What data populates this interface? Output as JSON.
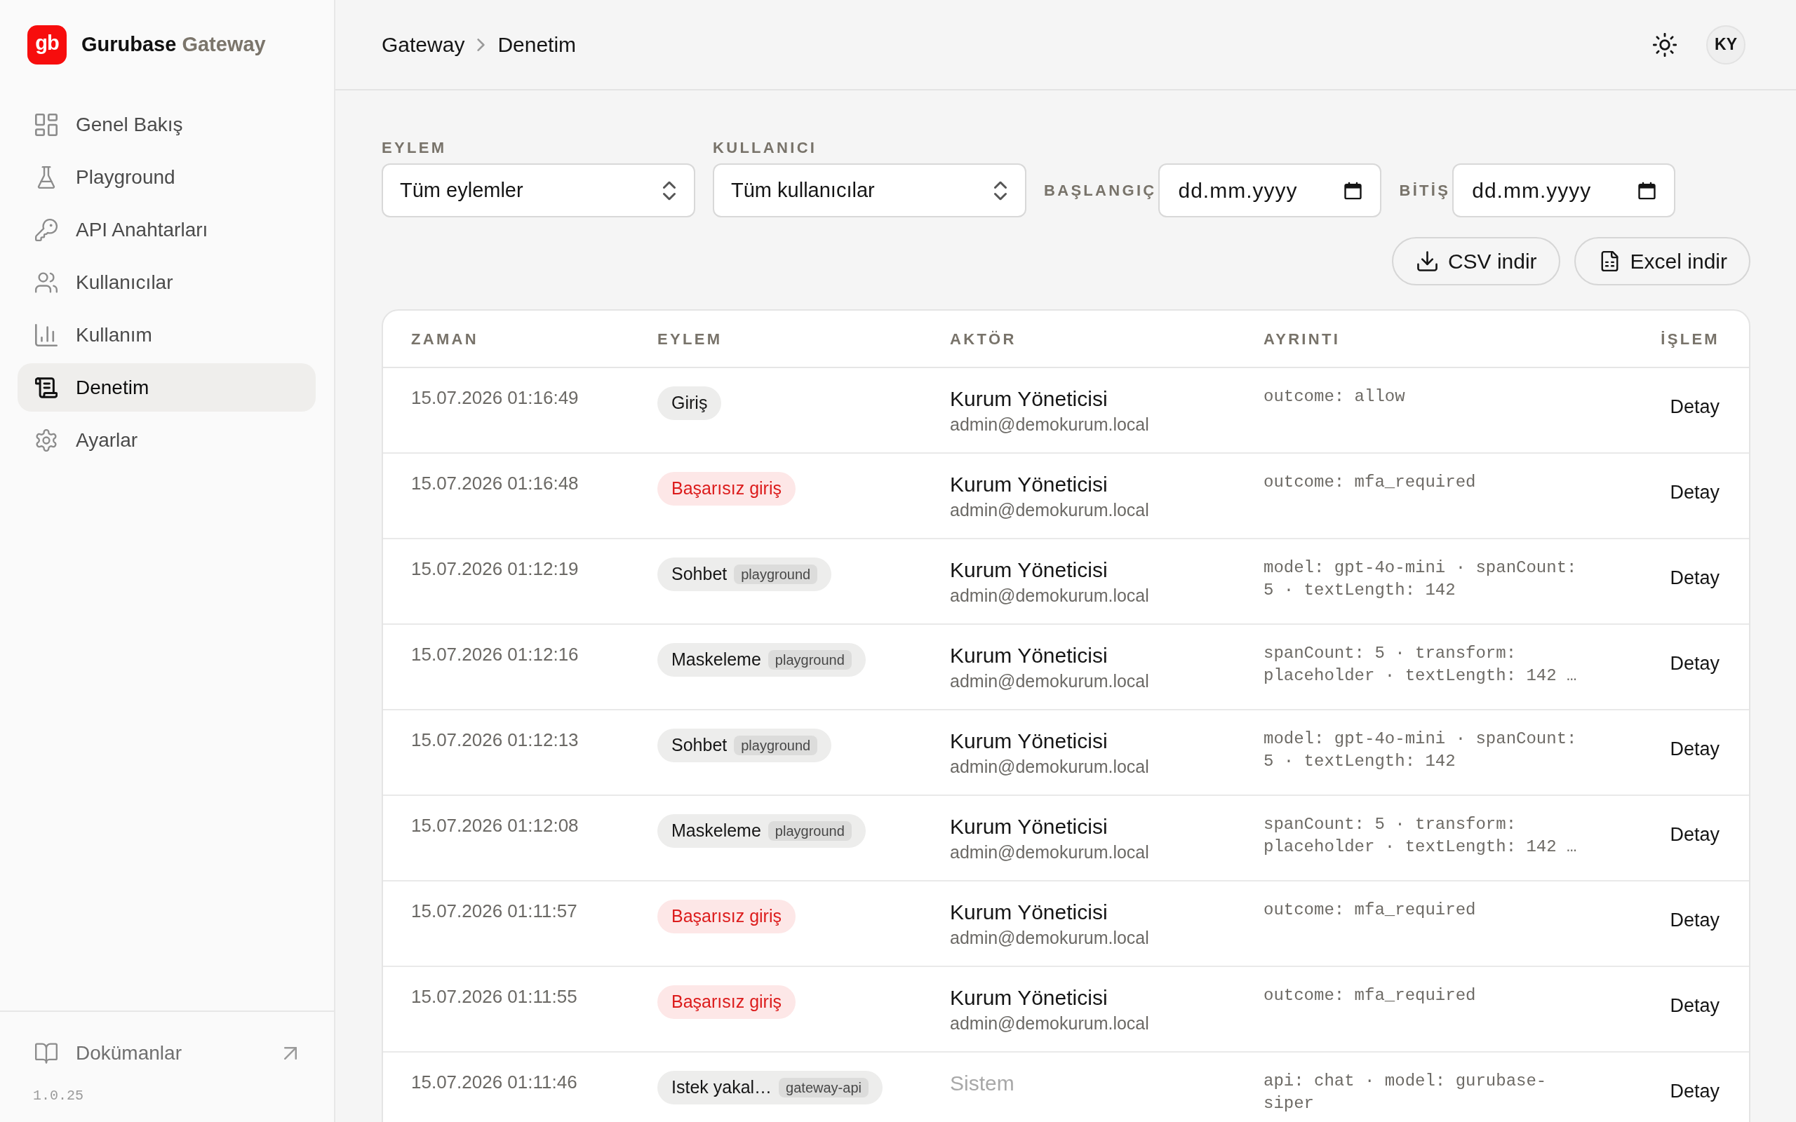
{
  "sidebar": {
    "brand": {
      "logo": "gb",
      "name": "Gurubase",
      "product": "Gateway"
    },
    "items": [
      {
        "label": "Genel Bakış",
        "selected": false
      },
      {
        "label": "Playground",
        "selected": false
      },
      {
        "label": "API Anahtarları",
        "selected": false
      },
      {
        "label": "Kullanıcılar",
        "selected": false
      },
      {
        "label": "Kullanım",
        "selected": false
      },
      {
        "label": "Denetim",
        "selected": true
      },
      {
        "label": "Ayarlar",
        "selected": false
      }
    ],
    "footer": {
      "docs_link": "Dokümanlar",
      "version": "1.0.25"
    }
  },
  "header": {
    "breadcrumb": [
      "Gateway",
      "Denetim"
    ],
    "avatar": "KY"
  },
  "filters": [
    {
      "kind": "select",
      "label": "EYLEM",
      "value": "Tüm eylemler"
    },
    {
      "kind": "select",
      "label": "KULLANICI",
      "value": "Tüm kullanıcılar"
    },
    {
      "kind": "date",
      "label": "BAŞLANGIÇ",
      "placeholder": "dd.mm.yyyy"
    },
    {
      "kind": "date",
      "label": "BİTİŞ",
      "placeholder": "dd.mm.yyyy"
    }
  ],
  "export_buttons": [
    {
      "label": "CSV indir"
    },
    {
      "label": "Excel indir"
    }
  ],
  "table": {
    "columns": [
      "ZAMAN",
      "EYLEM",
      "AKTÖR",
      "AYRINTI",
      "İŞLEM"
    ],
    "rows": [
      {
        "time": "15.07.2026 01:16:49",
        "action": {
          "label": "Giriş",
          "kind": "neutral"
        },
        "actor": {
          "kind": "user",
          "name": "Kurum Yöneticisi",
          "email": "admin@demokurum.local"
        },
        "detail": "outcome: allow",
        "link": "Detay"
      },
      {
        "time": "15.07.2026 01:16:48",
        "action": {
          "label": "Başarısız giriş",
          "kind": "danger"
        },
        "actor": {
          "kind": "user",
          "name": "Kurum Yöneticisi",
          "email": "admin@demokurum.local"
        },
        "detail": "outcome: mfa_required",
        "link": "Detay"
      },
      {
        "time": "15.07.2026 01:12:19",
        "action": {
          "label": "Sohbet",
          "kind": "neutral",
          "tag": "playground"
        },
        "actor": {
          "kind": "user",
          "name": "Kurum Yöneticisi",
          "email": "admin@demokurum.local"
        },
        "detail": "model: gpt-4o-mini · spanCount: 5 · textLength: 142",
        "link": "Detay"
      },
      {
        "time": "15.07.2026 01:12:16",
        "action": {
          "label": "Maskeleme",
          "kind": "neutral",
          "tag": "playground"
        },
        "actor": {
          "kind": "user",
          "name": "Kurum Yöneticisi",
          "email": "admin@demokurum.local"
        },
        "detail": "spanCount: 5 · transform: placeholder · textLength: 142 …",
        "link": "Detay"
      },
      {
        "time": "15.07.2026 01:12:13",
        "action": {
          "label": "Sohbet",
          "kind": "neutral",
          "tag": "playground"
        },
        "actor": {
          "kind": "user",
          "name": "Kurum Yöneticisi",
          "email": "admin@demokurum.local"
        },
        "detail": "model: gpt-4o-mini · spanCount: 5 · textLength: 142",
        "link": "Detay"
      },
      {
        "time": "15.07.2026 01:12:08",
        "action": {
          "label": "Maskeleme",
          "kind": "neutral",
          "tag": "playground"
        },
        "actor": {
          "kind": "user",
          "name": "Kurum Yöneticisi",
          "email": "admin@demokurum.local"
        },
        "detail": "spanCount: 5 · transform: placeholder · textLength: 142 …",
        "link": "Detay"
      },
      {
        "time": "15.07.2026 01:11:57",
        "action": {
          "label": "Başarısız giriş",
          "kind": "danger"
        },
        "actor": {
          "kind": "user",
          "name": "Kurum Yöneticisi",
          "email": "admin@demokurum.local"
        },
        "detail": "outcome: mfa_required",
        "link": "Detay"
      },
      {
        "time": "15.07.2026 01:11:55",
        "action": {
          "label": "Başarısız giriş",
          "kind": "danger"
        },
        "actor": {
          "kind": "user",
          "name": "Kurum Yöneticisi",
          "email": "admin@demokurum.local"
        },
        "detail": "outcome: mfa_required",
        "link": "Detay"
      },
      {
        "time": "15.07.2026 01:11:46",
        "action": {
          "label": "Istek yakal…",
          "kind": "neutral",
          "tag": "gateway-api"
        },
        "actor": {
          "kind": "system",
          "name": "Sistem"
        },
        "detail": "api: chat · model: gurubase-siper",
        "link": "Detay"
      }
    ]
  }
}
